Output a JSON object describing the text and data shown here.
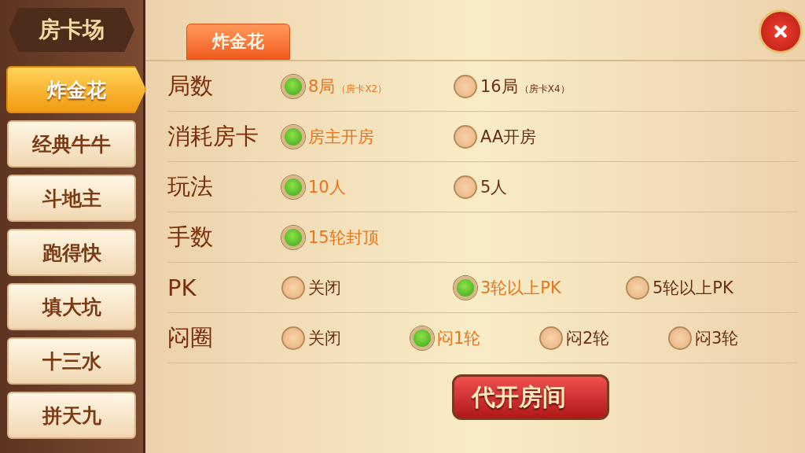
{
  "sidebar": {
    "title": "房卡场",
    "items": [
      {
        "label": "炸金花",
        "selected": true
      },
      {
        "label": "经典牛牛",
        "selected": false
      },
      {
        "label": "斗地主",
        "selected": false
      },
      {
        "label": "跑得快",
        "selected": false
      },
      {
        "label": "填大坑",
        "selected": false
      },
      {
        "label": "十三水",
        "selected": false
      },
      {
        "label": "拼天九",
        "selected": false
      }
    ]
  },
  "tabs": [
    {
      "label": "炸金花",
      "selected": true
    }
  ],
  "rows": [
    {
      "label": "局数",
      "options": [
        {
          "label": "8局",
          "note": "（房卡X2）",
          "selected": true
        },
        {
          "label": "16局",
          "note": "（房卡X4）",
          "selected": false
        }
      ]
    },
    {
      "label": "消耗房卡",
      "options": [
        {
          "label": "房主开房",
          "selected": true
        },
        {
          "label": "AA开房",
          "selected": false
        }
      ]
    },
    {
      "label": "玩法",
      "options": [
        {
          "label": "10人",
          "selected": true
        },
        {
          "label": "5人",
          "selected": false
        }
      ]
    },
    {
      "label": "手数",
      "options": [
        {
          "label": "15轮封顶",
          "selected": true
        }
      ]
    },
    {
      "label": "PK",
      "options": [
        {
          "label": "关闭",
          "selected": false
        },
        {
          "label": "3轮以上PK",
          "selected": true
        },
        {
          "label": "5轮以上PK",
          "selected": false
        }
      ]
    },
    {
      "label": "闷圈",
      "options": [
        {
          "label": "关闭",
          "selected": false
        },
        {
          "label": "闷1轮",
          "selected": true
        },
        {
          "label": "闷2轮",
          "selected": false
        },
        {
          "label": "闷3轮",
          "selected": false
        }
      ]
    }
  ],
  "action_button": {
    "label": "代开房间"
  }
}
